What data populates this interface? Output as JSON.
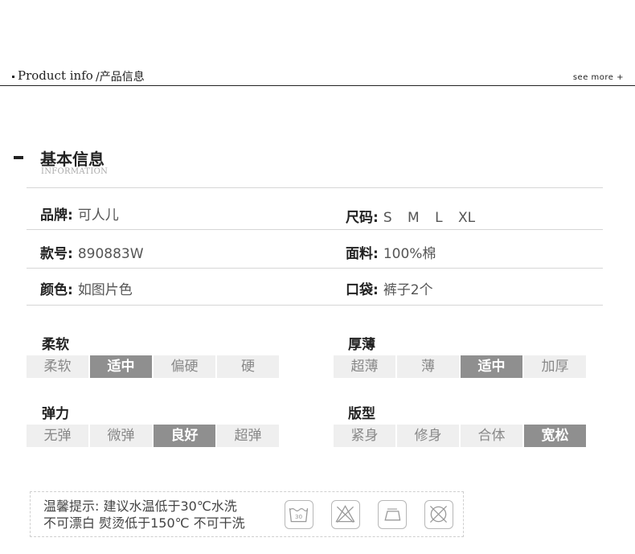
{
  "header": {
    "title_en": "Product info",
    "title_cn": "/产品信息",
    "see_more": "see more +"
  },
  "section": {
    "title": "基本信息",
    "subtitle": "INFORMATION"
  },
  "info": {
    "brand_label": "品牌:",
    "brand_value": "可人儿",
    "size_label": "尺码:",
    "size_value": "S M L XL",
    "style_no_label": "款号:",
    "style_no_value": "890883W",
    "fabric_label": "面料:",
    "fabric_value": "100%棉",
    "color_label": "颜色:",
    "color_value": "如图片色",
    "pocket_label": "口袋:",
    "pocket_value": "裤子2个"
  },
  "attributes": {
    "softness": {
      "title": "柔软",
      "options": [
        "柔软",
        "适中",
        "偏硬",
        "硬"
      ],
      "selected": "适中"
    },
    "thickness": {
      "title": "厚薄",
      "options": [
        "超薄",
        "薄",
        "适中",
        "加厚"
      ],
      "selected": "适中"
    },
    "elasticity": {
      "title": "弹力",
      "options": [
        "无弹",
        "微弹",
        "良好",
        "超弹"
      ],
      "selected": "良好"
    },
    "fit": {
      "title": "版型",
      "options": [
        "紧身",
        "修身",
        "合体",
        "宽松"
      ],
      "selected": "宽松"
    }
  },
  "care": {
    "line1": "温馨提示: 建议水温低于30℃水洗",
    "line2": "不可漂白 熨烫低于150℃ 不可干洗",
    "wash_temp": "30",
    "icons": [
      "wash-30-icon",
      "no-bleach-icon",
      "iron-icon",
      "no-dry-clean-icon"
    ]
  }
}
